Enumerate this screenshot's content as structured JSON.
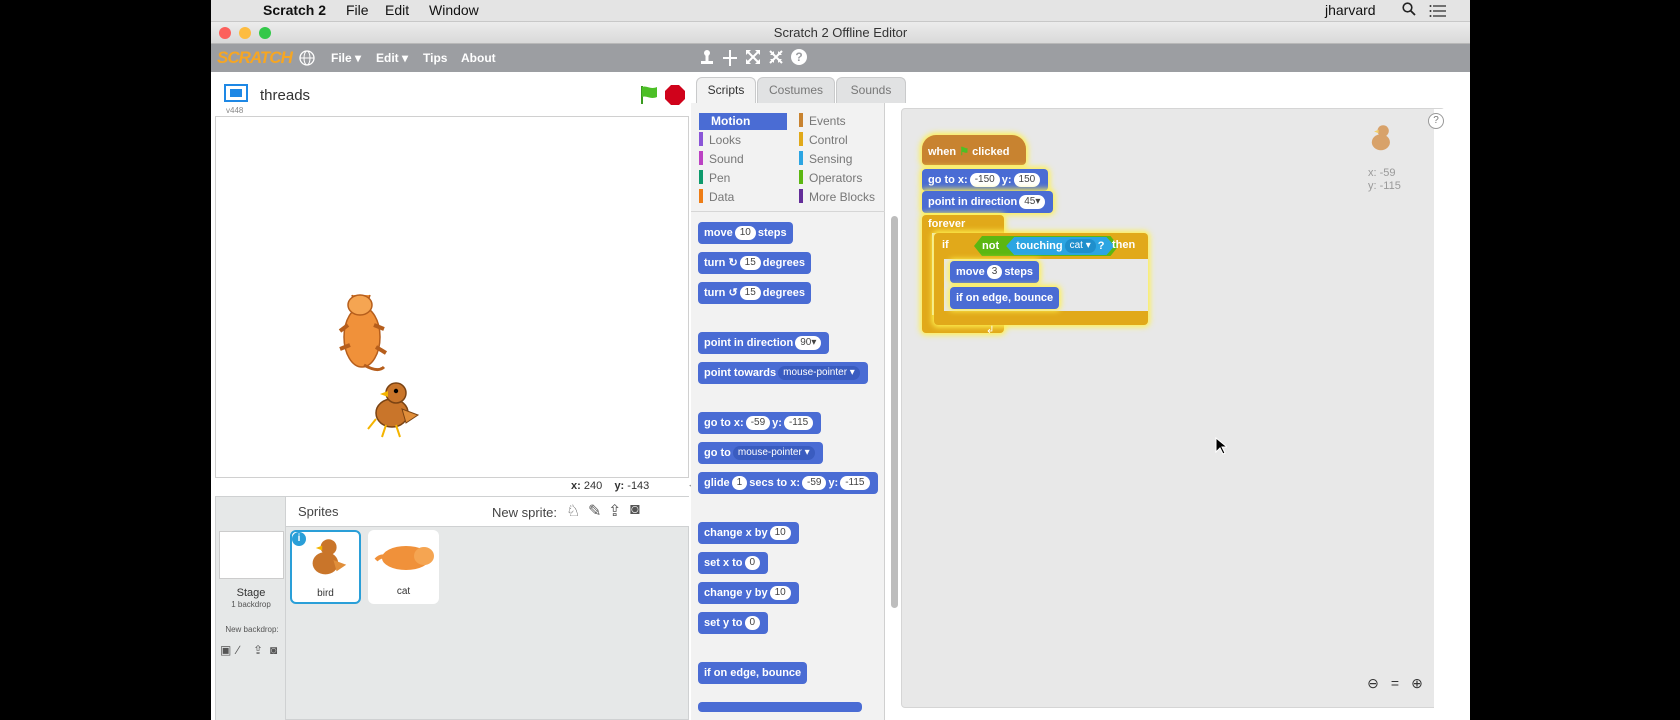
{
  "menubar": {
    "app": "Scratch 2",
    "items": [
      "File",
      "Edit",
      "Window"
    ],
    "user": "jharvard"
  },
  "window": {
    "title": "Scratch 2 Offline Editor"
  },
  "toolbar": {
    "logo": "SCRATCH",
    "menus": [
      "File ▾",
      "Edit ▾",
      "Tips",
      "About"
    ]
  },
  "stage": {
    "project_name": "threads",
    "version": "v448",
    "x_label": "x:",
    "x_value": "240",
    "y_label": "y:",
    "y_value": "-143"
  },
  "sprites": {
    "title": "Sprites",
    "new_sprite": "New sprite:",
    "stage_label": "Stage",
    "stage_sub": "1 backdrop",
    "new_backdrop": "New backdrop:",
    "items": [
      {
        "name": "bird"
      },
      {
        "name": "cat"
      }
    ]
  },
  "tabs": [
    "Scripts",
    "Costumes",
    "Sounds"
  ],
  "categories": {
    "left": [
      "Motion",
      "Looks",
      "Sound",
      "Pen",
      "Data"
    ],
    "right": [
      "Events",
      "Control",
      "Sensing",
      "Operators",
      "More Blocks"
    ],
    "colors": {
      "Motion": "#4a6cd4",
      "Looks": "#8a55d7",
      "Sound": "#bb42c3",
      "Pen": "#0e9a6c",
      "Data": "#ee7d16",
      "Events": "#c88330",
      "Control": "#e1a91a",
      "Sensing": "#2ca5e2",
      "Operators": "#5cb712",
      "More Blocks": "#632d99"
    }
  },
  "palette": {
    "move": {
      "a": "move",
      "v": "10",
      "b": "steps"
    },
    "turn_cw": {
      "a": "turn",
      "v": "15",
      "b": "degrees"
    },
    "turn_ccw": {
      "a": "turn",
      "v": "15",
      "b": "degrees"
    },
    "point_dir": {
      "a": "point in direction",
      "v": "90▾"
    },
    "point_towards": {
      "a": "point towards",
      "v": "mouse-pointer ▾"
    },
    "goto_xy": {
      "a": "go to x:",
      "v1": "-59",
      "b": "y:",
      "v2": "-115"
    },
    "goto": {
      "a": "go to",
      "v": "mouse-pointer ▾"
    },
    "glide": {
      "a": "glide",
      "v1": "1",
      "b": "secs to x:",
      "v2": "-59",
      "c": "y:",
      "v3": "-115"
    },
    "change_x": {
      "a": "change x by",
      "v": "10"
    },
    "set_x": {
      "a": "set x to",
      "v": "0"
    },
    "change_y": {
      "a": "change y by",
      "v": "10"
    },
    "set_y": {
      "a": "set y to",
      "v": "0"
    },
    "bounce": {
      "a": "if on edge, bounce"
    }
  },
  "script": {
    "hat": {
      "a": "when",
      "b": "clicked"
    },
    "goto": {
      "a": "go to x:",
      "v1": "-150",
      "b": "y:",
      "v2": "150"
    },
    "point": {
      "a": "point in direction",
      "v": "45▾"
    },
    "forever": "forever",
    "if": {
      "a": "if",
      "not": "not",
      "touching": "touching",
      "target": "cat ▾",
      "q": "?",
      "then": "then"
    },
    "move": {
      "a": "move",
      "v": "3",
      "b": "steps"
    },
    "bounce": "if on edge, bounce"
  },
  "sprite_info": {
    "x": "x: -59",
    "y": "y: -115"
  }
}
